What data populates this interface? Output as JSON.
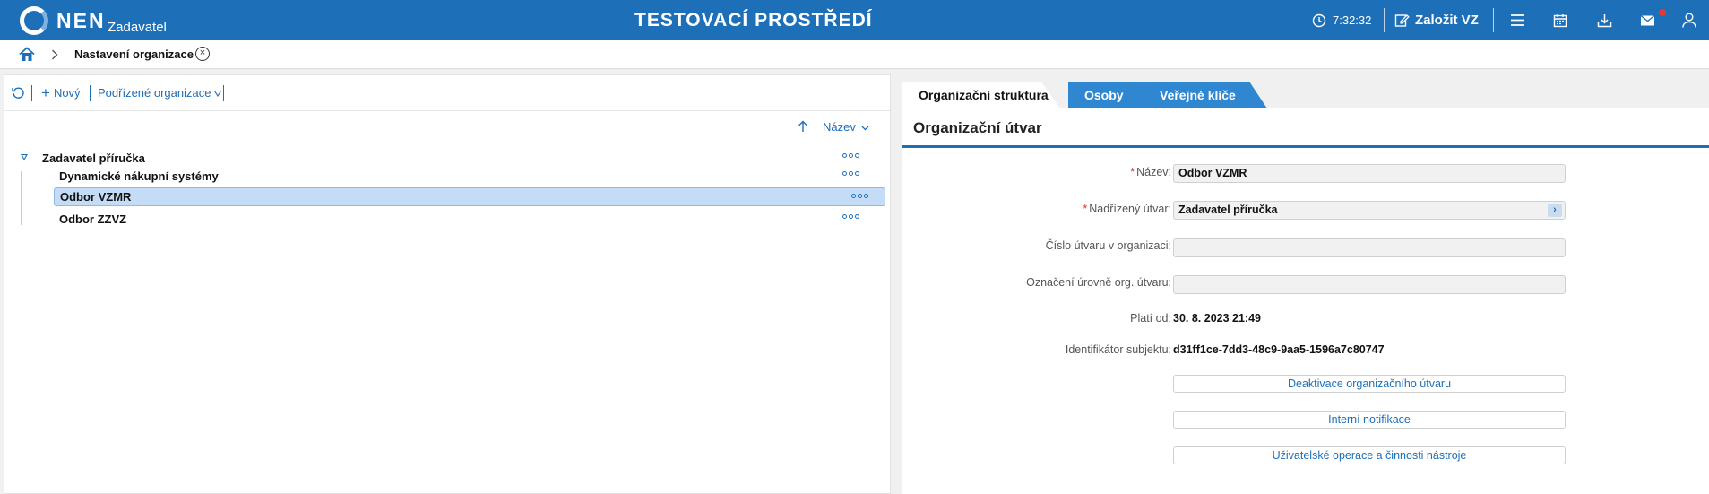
{
  "header": {
    "logo_text": "NEN",
    "logo_sub": "Zadavatel",
    "environment": "TESTOVACÍ PROSTŘEDÍ",
    "time": "7:32:32",
    "create_label": "Založit VZ",
    "icons": [
      "clock-icon",
      "edit-icon",
      "menu-icon",
      "calendar-icon",
      "download-icon",
      "mail-icon",
      "user-icon"
    ]
  },
  "breadcrumb": {
    "current": "Nastavení organizace"
  },
  "left": {
    "toolbar": {
      "new_label": "Nový",
      "sub_orgs_label": "Podřízené organizace"
    },
    "sort_label": "Název",
    "tree": [
      {
        "label": "Zadavatel příručka",
        "level": 0,
        "expanded": true
      },
      {
        "label": "Dynamické nákupní systémy",
        "level": 1
      },
      {
        "label": "Odbor VZMR",
        "level": 1,
        "selected": true
      },
      {
        "label": "Odbor ZZVZ",
        "level": 1
      }
    ]
  },
  "right": {
    "tabs": [
      "Organizační struktura",
      "Osoby",
      "Veřejné klíče"
    ],
    "active_tab": "Organizační struktura",
    "section_title": "Organizační útvar",
    "fields": {
      "name_label": "Název:",
      "name_value": "Odbor VZMR",
      "parent_label": "Nadřízený útvar:",
      "parent_value": "Zadavatel příručka",
      "number_label": "Číslo útvaru v organizaci:",
      "number_value": "",
      "level_label": "Označení úrovně org. útvaru:",
      "level_value": "",
      "valid_label": "Platí od:",
      "valid_value": "30. 8. 2023 21:49",
      "subject_label": "Identifikátor subjektu:",
      "subject_value": "d31ff1ce-7dd3-48c9-9aa5-1596a7c80747"
    },
    "buttons": {
      "deactivate": "Deaktivace organizačního útvaru",
      "notifications": "Interní notifikace",
      "operations": "Uživatelské operace a činnosti nástroje"
    }
  },
  "colors": {
    "brand": "#1d6fb8",
    "tab_blue": "#2f86d1",
    "selected_row": "#c5dcf6",
    "required": "#d32f2f"
  }
}
